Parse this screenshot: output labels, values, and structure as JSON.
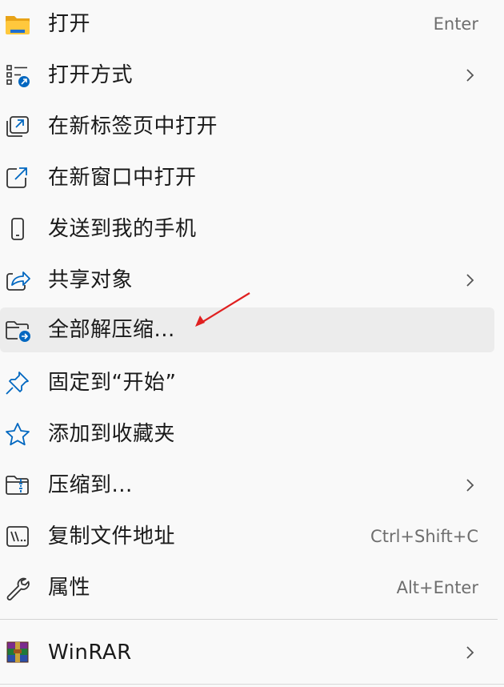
{
  "menu": {
    "items": [
      {
        "id": "open",
        "icon": "folder-icon",
        "label": "打开",
        "shortcut": "Enter"
      },
      {
        "id": "open-with",
        "icon": "open-with-icon",
        "label": "打开方式",
        "submenu": true
      },
      {
        "id": "open-new-tab",
        "icon": "new-tab-icon",
        "label": "在新标签页中打开"
      },
      {
        "id": "open-new-window",
        "icon": "new-window-icon",
        "label": "在新窗口中打开"
      },
      {
        "id": "send-to-phone",
        "icon": "phone-icon",
        "label": "发送到我的手机"
      },
      {
        "id": "share",
        "icon": "share-icon",
        "label": "共享对象",
        "submenu": true
      },
      {
        "id": "extract-all",
        "icon": "extract-folder-icon",
        "label": "全部解压缩...",
        "highlighted": true
      },
      {
        "id": "pin-start",
        "icon": "pin-icon",
        "label": "固定到“开始”"
      },
      {
        "id": "add-favorites",
        "icon": "star-icon",
        "label": "添加到收藏夹"
      },
      {
        "id": "compress-to",
        "icon": "zip-folder-icon",
        "label": "压缩到...",
        "submenu": true
      },
      {
        "id": "copy-path",
        "icon": "copy-path-icon",
        "label": "复制文件地址",
        "shortcut": "Ctrl+Shift+C"
      },
      {
        "id": "properties",
        "icon": "wrench-icon",
        "label": "属性",
        "shortcut": "Alt+Enter"
      },
      {
        "id": "winrar",
        "icon": "winrar-icon",
        "label": "WinRAR",
        "submenu": true
      }
    ]
  },
  "colors": {
    "accent": "#0067c0",
    "annotation_arrow": "#e02020",
    "hover_bg": "#ececec",
    "menu_bg": "#f9f9f9"
  }
}
